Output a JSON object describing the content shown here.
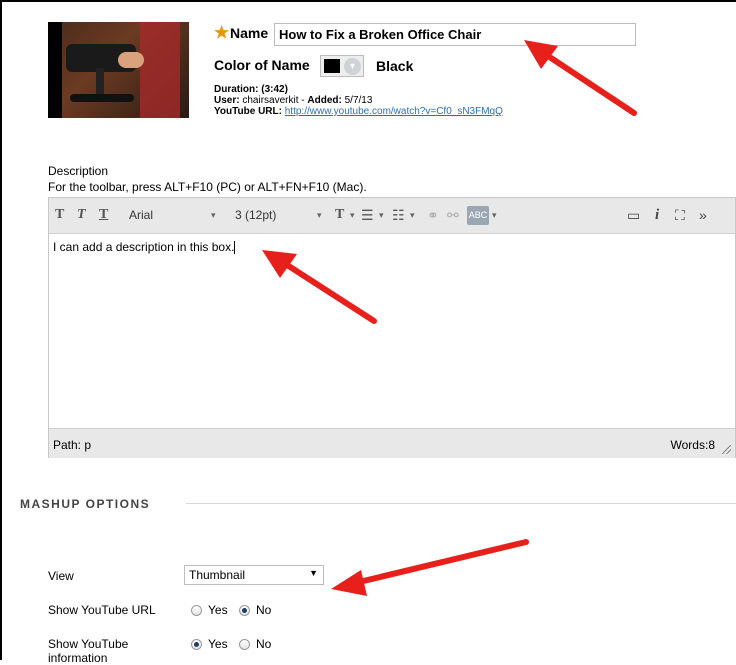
{
  "video": {
    "name_label": "Name",
    "name_value": "How to Fix a Broken Office Chair",
    "color_label": "Color of Name",
    "color_name": "Black",
    "swatch_color": "#000000",
    "duration_label": "Duration:",
    "duration_value": "(3:42)",
    "user_label": "User:",
    "user_value": "chairsaverkit",
    "added_label": "Added:",
    "added_value": "5/7/13",
    "url_label": "YouTube URL:",
    "url_value": "http://www.youtube.com/watch?v=Cf0_sN3FMqQ"
  },
  "description": {
    "label": "Description",
    "hint": "For the toolbar, press ALT+F10 (PC) or ALT+FN+F10 (Mac).",
    "content": "I can add a description in this box.",
    "toolbar": {
      "font": "Arial",
      "size": "3 (12pt)",
      "spell_label": "ABC"
    },
    "path_label": "Path:",
    "path_value": "p",
    "words_label": "Words:",
    "words_value": "8"
  },
  "mashup": {
    "title": "MASHUP OPTIONS",
    "view_label": "View",
    "view_value": "Thumbnail",
    "show_url_label": "Show YouTube URL",
    "show_info_label_1": "Show YouTube",
    "show_info_label_2": "information",
    "yes": "Yes",
    "no": "No"
  },
  "annotation_color": "#e8201c",
  "icons": [
    "required-star-icon",
    "bold-icon",
    "italic-icon",
    "underline-icon",
    "text-color-icon",
    "bullet-list-icon",
    "numbered-list-icon",
    "spellcheck-icon",
    "link-icon",
    "unlink-icon",
    "preview-icon",
    "info-icon",
    "fullscreen-icon",
    "more-icon",
    "resize-grip-icon"
  ]
}
